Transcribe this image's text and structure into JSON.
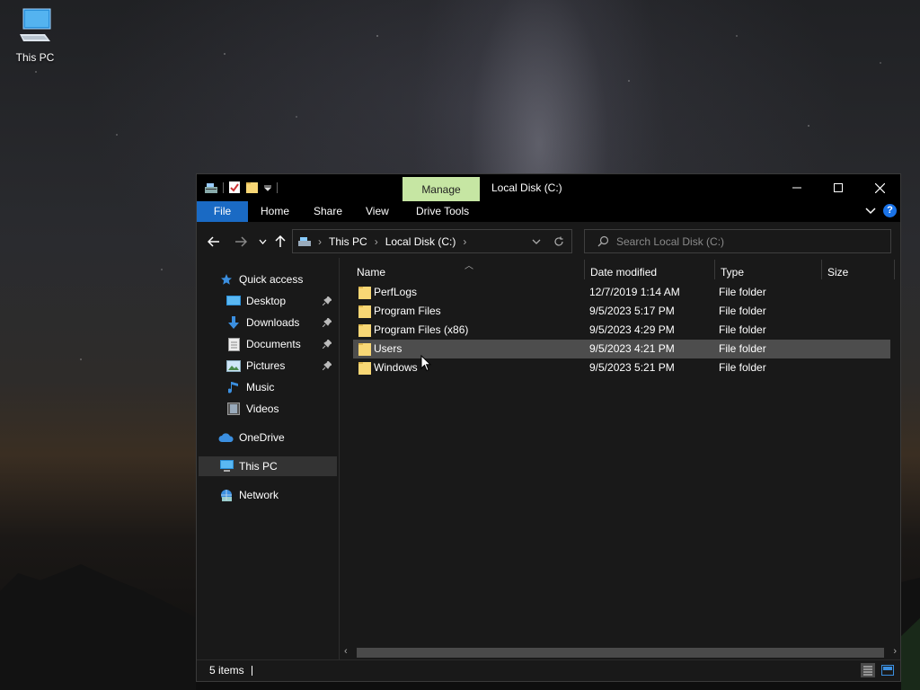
{
  "desktop": {
    "icon_label": "This PC",
    "icon_name": "this-pc-icon"
  },
  "window": {
    "title": "Local Disk (C:)",
    "contextual_tab": "Manage",
    "quick_access_toolbar": [
      "explorer-icon",
      "properties-icon",
      "new-folder-icon",
      "customize-dropdown-icon"
    ],
    "caption_buttons": [
      "minimize",
      "maximize",
      "close"
    ]
  },
  "ribbon": {
    "tabs": [
      "File",
      "Home",
      "Share",
      "View",
      "Drive Tools"
    ],
    "active_tab": "File",
    "active_color": "#1a6ac4",
    "contextual_color": "#c6e6a3"
  },
  "address_bar": {
    "breadcrumbs": [
      "This PC",
      "Local Disk (C:)"
    ]
  },
  "search": {
    "placeholder": "Search Local Disk (C:)"
  },
  "nav_pane": {
    "quick_access": "Quick access",
    "pinned": [
      {
        "label": "Desktop",
        "icon": "desktop-icon",
        "pinned": true
      },
      {
        "label": "Downloads",
        "icon": "download-icon",
        "pinned": true
      },
      {
        "label": "Documents",
        "icon": "documents-icon",
        "pinned": true
      },
      {
        "label": "Pictures",
        "icon": "pictures-icon",
        "pinned": true
      },
      {
        "label": "Music",
        "icon": "music-icon",
        "pinned": false
      },
      {
        "label": "Videos",
        "icon": "videos-icon",
        "pinned": false
      }
    ],
    "onedrive": "OneDrive",
    "this_pc": "This PC",
    "network": "Network",
    "selected": "This PC"
  },
  "file_list": {
    "columns": [
      "Name",
      "Date modified",
      "Type",
      "Size"
    ],
    "sorted_by": "Name",
    "rows": [
      {
        "name": "PerfLogs",
        "date": "12/7/2019 1:14 AM",
        "type": "File folder",
        "size": ""
      },
      {
        "name": "Program Files",
        "date": "9/5/2023 5:17 PM",
        "type": "File folder",
        "size": ""
      },
      {
        "name": "Program Files (x86)",
        "date": "9/5/2023 4:29 PM",
        "type": "File folder",
        "size": ""
      },
      {
        "name": "Users",
        "date": "9/5/2023 4:21 PM",
        "type": "File folder",
        "size": ""
      },
      {
        "name": "Windows",
        "date": "9/5/2023 5:21 PM",
        "type": "File folder",
        "size": ""
      }
    ],
    "hovered_row": "Users"
  },
  "status_bar": {
    "item_count": "5 items",
    "view_modes": [
      "details-view",
      "large-icons-view"
    ],
    "active_view": "details-view"
  }
}
